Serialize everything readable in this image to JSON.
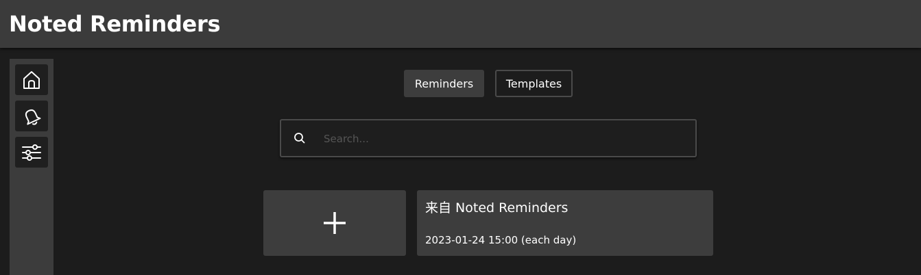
{
  "header": {
    "title": "Noted Reminders"
  },
  "sidebar": {
    "items": [
      {
        "name": "home",
        "icon": "home-icon"
      },
      {
        "name": "reminders",
        "icon": "bell-icon"
      },
      {
        "name": "settings",
        "icon": "sliders-icon"
      }
    ]
  },
  "tabs": [
    {
      "label": "Reminders",
      "active": true
    },
    {
      "label": "Templates",
      "active": false
    }
  ],
  "search": {
    "placeholder": "Search...",
    "value": "",
    "icon": "search-icon"
  },
  "add_card": {
    "icon": "plus-icon"
  },
  "reminders": [
    {
      "title": "来自 Noted Reminders",
      "time": "2023-01-24 15:00 (each day)"
    }
  ],
  "colors": {
    "background": "#1c1c1c",
    "header": "#3b3b3b",
    "sidebar": "#3c3c3c",
    "card": "#3d3d3d",
    "text": "#ffffff"
  }
}
